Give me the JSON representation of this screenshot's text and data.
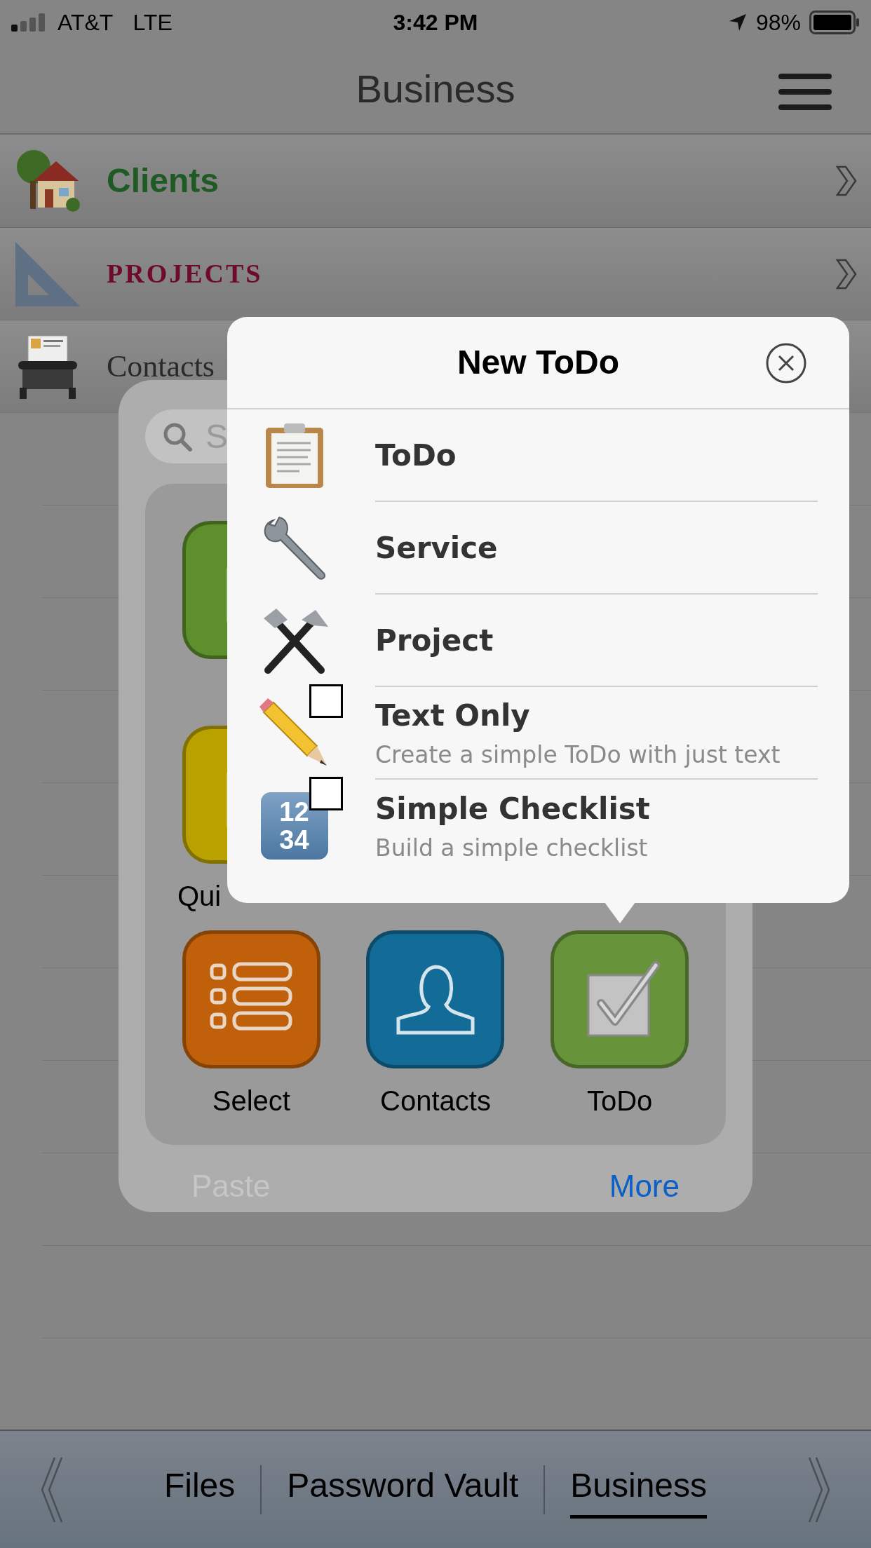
{
  "status_bar": {
    "carrier": "AT&T",
    "network": "LTE",
    "time": "3:42 PM",
    "battery": "98%"
  },
  "header": {
    "title": "Business"
  },
  "folders": [
    {
      "label": "Clients",
      "color": "#1f5a24",
      "kind": "house",
      "chevron": true
    },
    {
      "label": "PROJECTS",
      "color": "#6e0a2a",
      "kind": "set-square",
      "chevron": true
    },
    {
      "label": "Contacts",
      "color": "#2a2a2a",
      "kind": "card-file",
      "chevron": false
    }
  ],
  "quick_panel": {
    "search": {
      "placeholder": "S"
    },
    "rows": [
      {
        "items": [
          {
            "kind": "note",
            "color": "#5d8f2c"
          }
        ]
      },
      {
        "items": [
          {
            "kind": "note",
            "color": "#b9a200",
            "label": "Qui"
          }
        ]
      },
      {
        "items": [
          {
            "kind": "list",
            "color": "#c0600a",
            "label": "Select"
          },
          {
            "kind": "person",
            "color": "#136c98",
            "label": "Contacts"
          },
          {
            "kind": "check",
            "color": "#67933a",
            "label": "ToDo"
          }
        ]
      }
    ],
    "paste": {
      "label": "Paste",
      "disabled": true
    },
    "more": "More"
  },
  "popover": {
    "title": "New ToDo",
    "items": [
      {
        "kind": "plain",
        "label": "ToDo"
      },
      {
        "kind": "plain",
        "label": "Service"
      },
      {
        "kind": "plain",
        "label": "Project"
      },
      {
        "kind": "checkbox",
        "checked": false,
        "label": "Text Only",
        "subtitle": "Create a simple ToDo with just text"
      },
      {
        "kind": "checkbox",
        "checked": false,
        "keycap_rows": [
          "12",
          "34"
        ],
        "label": "Simple Checklist",
        "subtitle": "Build a simple checklist"
      }
    ]
  },
  "tabs": [
    {
      "label": "Files",
      "selected": false
    },
    {
      "label": "Password Vault",
      "selected": false
    },
    {
      "label": "Business",
      "selected": true
    }
  ]
}
